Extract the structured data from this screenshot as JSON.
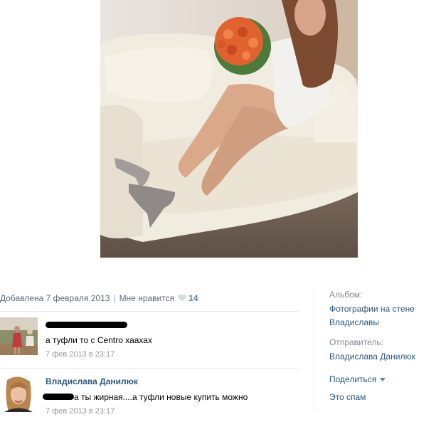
{
  "post": {
    "added": "Добавлена 7 февраля 2013",
    "separator": "|",
    "like_label": "Мне нравится",
    "like_count": "14"
  },
  "comments": [
    {
      "author": "",
      "text": "а туфли то с Centro хаахах",
      "date": "7 фев 2013 в 23:17"
    },
    {
      "author": "Владислава Данилюк",
      "text": "а ты жирная....а туфли новые купить можно",
      "date": "7 фев 2013 в 23:17"
    }
  ],
  "sidebar": {
    "album_label": "Альбом:",
    "album_name": "Фотографии на стене Владиславы",
    "sender_label": "Отправитель:",
    "sender_name": "Владислава Данилюк",
    "share": "Поделиться",
    "spam": "Это спам"
  },
  "icons": {
    "heart": "heart-icon",
    "share_arrow": "chevron-down-icon"
  },
  "colors": {
    "link": "#2b587a",
    "muted": "#808b96",
    "likes": "#5e82a8"
  }
}
